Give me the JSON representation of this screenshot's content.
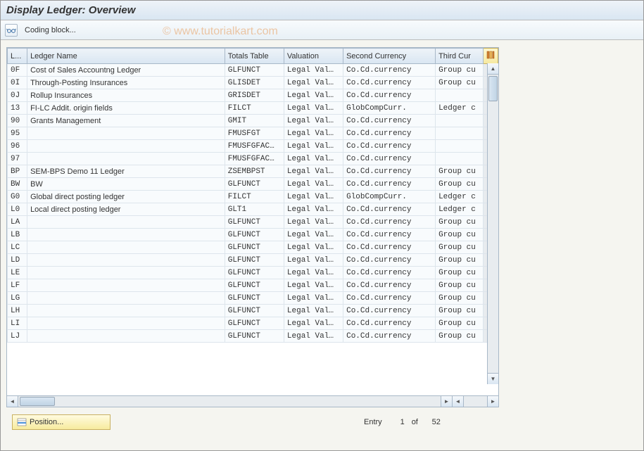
{
  "header": {
    "title": "Display Ledger: Overview"
  },
  "toolbar": {
    "coding_block": "Coding block..."
  },
  "watermark": "© www.tutorialkart.com",
  "columns": {
    "ledger": "L...",
    "name": "Ledger Name",
    "totals": "Totals Table",
    "valuation": "Valuation",
    "second": "Second Currency",
    "third": "Third Cur"
  },
  "rows": [
    {
      "ld": "0F",
      "name": "Cost of Sales Accountng Ledger",
      "tt": "GLFUNCT",
      "val": "Legal Val…",
      "sec": "Co.Cd.currency",
      "thd": "Group cu"
    },
    {
      "ld": "0I",
      "name": "Through-Posting Insurances",
      "tt": "GLISDET",
      "val": "Legal Val…",
      "sec": "Co.Cd.currency",
      "thd": "Group cu"
    },
    {
      "ld": "0J",
      "name": "Rollup Insurances",
      "tt": "GRISDET",
      "val": "Legal Val…",
      "sec": "Co.Cd.currency",
      "thd": ""
    },
    {
      "ld": "13",
      "name": "FI-LC Addit. origin fields",
      "tt": "FILCT",
      "val": "Legal Val…",
      "sec": "GlobCompCurr.",
      "thd": "Ledger c"
    },
    {
      "ld": "90",
      "name": "Grants Management",
      "tt": "GMIT",
      "val": "Legal Val…",
      "sec": "Co.Cd.currency",
      "thd": ""
    },
    {
      "ld": "95",
      "name": "",
      "tt": "FMUSFGT",
      "val": "Legal Val…",
      "sec": "Co.Cd.currency",
      "thd": ""
    },
    {
      "ld": "96",
      "name": "",
      "tt": "FMUSFGFAC…",
      "val": "Legal Val…",
      "sec": "Co.Cd.currency",
      "thd": ""
    },
    {
      "ld": "97",
      "name": "",
      "tt": "FMUSFGFAC…",
      "val": "Legal Val…",
      "sec": "Co.Cd.currency",
      "thd": ""
    },
    {
      "ld": "BP",
      "name": "SEM-BPS Demo 11 Ledger",
      "tt": "ZSEMBPST",
      "val": "Legal Val…",
      "sec": "Co.Cd.currency",
      "thd": "Group cu"
    },
    {
      "ld": "BW",
      "name": "BW",
      "tt": "GLFUNCT",
      "val": "Legal Val…",
      "sec": "Co.Cd.currency",
      "thd": "Group cu"
    },
    {
      "ld": "G0",
      "name": "Global direct posting ledger",
      "tt": "FILCT",
      "val": "Legal Val…",
      "sec": "GlobCompCurr.",
      "thd": "Ledger c"
    },
    {
      "ld": "L0",
      "name": "Local direct posting ledger",
      "tt": "GLT1",
      "val": "Legal Val…",
      "sec": "Co.Cd.currency",
      "thd": "Ledger c"
    },
    {
      "ld": "LA",
      "name": "",
      "tt": "GLFUNCT",
      "val": "Legal Val…",
      "sec": "Co.Cd.currency",
      "thd": "Group cu"
    },
    {
      "ld": "LB",
      "name": "",
      "tt": "GLFUNCT",
      "val": "Legal Val…",
      "sec": "Co.Cd.currency",
      "thd": "Group cu"
    },
    {
      "ld": "LC",
      "name": "",
      "tt": "GLFUNCT",
      "val": "Legal Val…",
      "sec": "Co.Cd.currency",
      "thd": "Group cu"
    },
    {
      "ld": "LD",
      "name": "",
      "tt": "GLFUNCT",
      "val": "Legal Val…",
      "sec": "Co.Cd.currency",
      "thd": "Group cu"
    },
    {
      "ld": "LE",
      "name": "",
      "tt": "GLFUNCT",
      "val": "Legal Val…",
      "sec": "Co.Cd.currency",
      "thd": "Group cu"
    },
    {
      "ld": "LF",
      "name": "",
      "tt": "GLFUNCT",
      "val": "Legal Val…",
      "sec": "Co.Cd.currency",
      "thd": "Group cu"
    },
    {
      "ld": "LG",
      "name": "",
      "tt": "GLFUNCT",
      "val": "Legal Val…",
      "sec": "Co.Cd.currency",
      "thd": "Group cu"
    },
    {
      "ld": "LH",
      "name": "",
      "tt": "GLFUNCT",
      "val": "Legal Val…",
      "sec": "Co.Cd.currency",
      "thd": "Group cu"
    },
    {
      "ld": "LI",
      "name": "",
      "tt": "GLFUNCT",
      "val": "Legal Val…",
      "sec": "Co.Cd.currency",
      "thd": "Group cu"
    },
    {
      "ld": "LJ",
      "name": "",
      "tt": "GLFUNCT",
      "val": "Legal Val…",
      "sec": "Co.Cd.currency",
      "thd": "Group cu"
    }
  ],
  "footer": {
    "position_label": "Position...",
    "entry_label": "Entry",
    "entry_current": "1",
    "of_label": "of",
    "entry_total": "52"
  }
}
